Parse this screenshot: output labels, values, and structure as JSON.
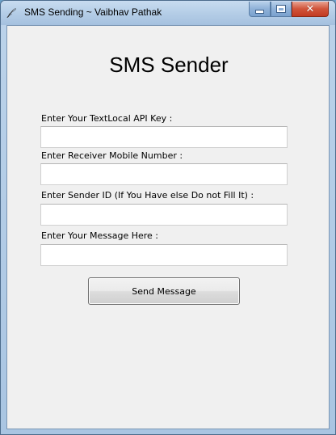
{
  "window": {
    "title": "SMS Sending ~ Vaibhav Pathak",
    "app_icon": "feather-icon",
    "controls": {
      "minimize_icon": "minimize-icon",
      "maximize_icon": "maximize-icon",
      "close_icon": "close-icon",
      "close_glyph": "✕"
    }
  },
  "form": {
    "heading": "SMS Sender",
    "api_key": {
      "label": "Enter Your TextLocal API Key :",
      "value": ""
    },
    "receiver": {
      "label": "Enter Receiver Mobile Number :",
      "value": ""
    },
    "sender_id": {
      "label": "Enter Sender ID (If You Have else Do not Fill It) :",
      "value": ""
    },
    "message": {
      "label": "Enter Your Message Here :",
      "value": ""
    },
    "send_label": "Send Message"
  },
  "colors": {
    "titlebar": "#b3cce6",
    "client_bg": "#f0f0f0",
    "close_red": "#c23b22"
  }
}
